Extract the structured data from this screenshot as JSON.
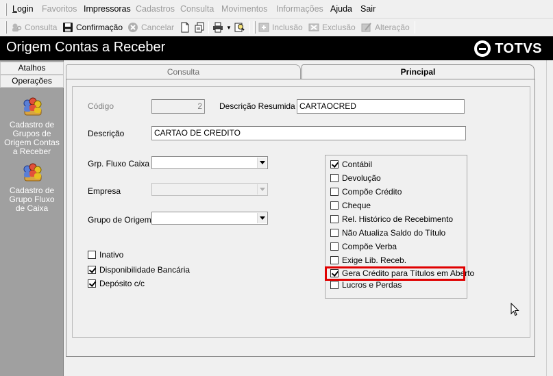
{
  "menu": {
    "items": [
      {
        "label": "Login",
        "enabled": true
      },
      {
        "label": "Favoritos",
        "enabled": false
      },
      {
        "label": "Impressoras",
        "enabled": true
      },
      {
        "label": "Cadastros",
        "enabled": false
      },
      {
        "label": "Consulta",
        "enabled": false
      },
      {
        "label": "Movimentos",
        "enabled": false
      },
      {
        "label": "Informações",
        "enabled": false
      },
      {
        "label": "Ajuda",
        "enabled": true
      },
      {
        "label": "Sair",
        "enabled": true
      }
    ]
  },
  "toolbar": {
    "consulta_label": "Consulta",
    "confirmacao_label": "Confirmação",
    "cancelar_label": "Cancelar",
    "inclusao_label": "Inclusão",
    "exclusao_label": "Exclusão",
    "alteracao_label": "Alteração"
  },
  "title": {
    "text": "Origem Contas a Receber",
    "logo": "TOTVS"
  },
  "sidebar": {
    "tabs": [
      "Atalhos",
      "Operações"
    ],
    "shortcuts": [
      {
        "label": "Cadastro de Grupos de Origem Contas a Receber",
        "icon": "users-group-icon"
      },
      {
        "label": "Cadastro de Grupo Fluxo de Caixa",
        "icon": "users-group-icon"
      }
    ]
  },
  "tabs": {
    "consulta": "Consulta",
    "principal": "Principal"
  },
  "form": {
    "codigo_label": "Código",
    "codigo_value": "2",
    "descricao_resumida_label": "Descrição Resumida",
    "descricao_resumida_value": "CARTAOCRED",
    "descricao_label": "Descrição",
    "descricao_value": "CARTAO DE CREDITO",
    "grp_fluxo_label": "Grp. Fluxo Caixa",
    "grp_fluxo_value": "",
    "empresa_label": "Empresa",
    "empresa_value": "",
    "grupo_origem_label": "Grupo de Origem",
    "grupo_origem_value": ""
  },
  "left_checks": [
    {
      "label": "Inativo",
      "checked": false
    },
    {
      "label": "Disponibilidade Bancária",
      "checked": true
    },
    {
      "label": "Depósito c/c",
      "checked": true
    }
  ],
  "flags": [
    {
      "label": "Contábil",
      "checked": true
    },
    {
      "label": "Devolução",
      "checked": false
    },
    {
      "label": "Compõe Crédito",
      "checked": false
    },
    {
      "label": "Cheque",
      "checked": false
    },
    {
      "label": "Rel. Histórico de Recebimento",
      "checked": false
    },
    {
      "label": "Não Atualiza Saldo do Título",
      "checked": false
    },
    {
      "label": "Compõe Verba",
      "checked": false
    },
    {
      "label": "Exige Lib. Receb.",
      "checked": false
    },
    {
      "label": "Gera Crédito para Títulos em Aberto",
      "checked": true
    },
    {
      "label": "Lucros e Perdas",
      "checked": false
    }
  ],
  "colors": {
    "highlight": "#e00000",
    "title_bg": "#000000",
    "sidebar_bg": "#a0a0a0"
  }
}
